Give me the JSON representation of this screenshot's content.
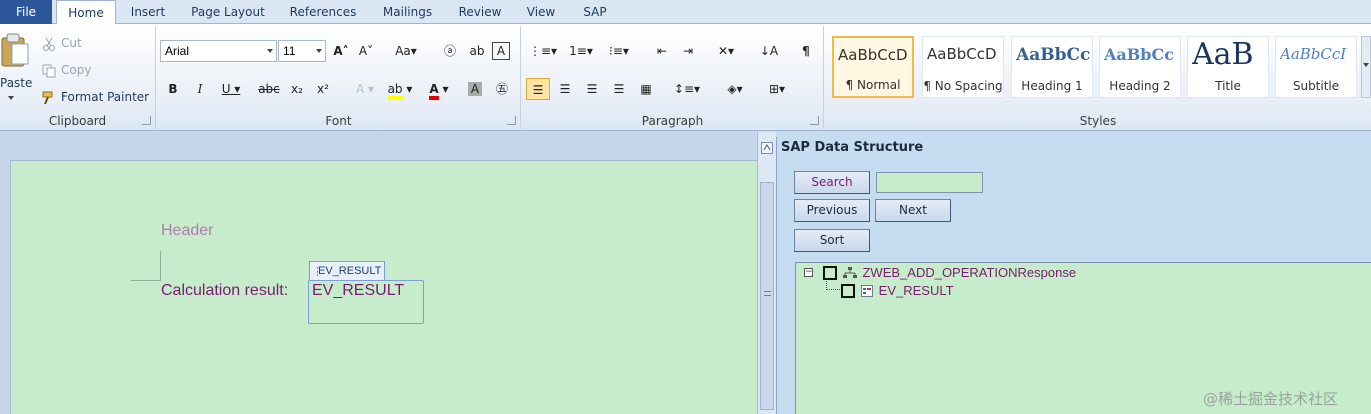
{
  "tabs": {
    "file": "File",
    "items": [
      "Home",
      "Insert",
      "Page Layout",
      "References",
      "Mailings",
      "Review",
      "View",
      "SAP"
    ]
  },
  "clipboard": {
    "paste": "Paste",
    "cut": "Cut",
    "copy": "Copy",
    "format_painter": "Format Painter",
    "label": "Clipboard"
  },
  "font": {
    "family": "Arial",
    "size": "11",
    "label": "Font"
  },
  "paragraph": {
    "label": "Paragraph"
  },
  "styles": {
    "label": "Styles",
    "items": [
      {
        "sample": "AaBbCcD",
        "name": "¶ Normal"
      },
      {
        "sample": "AaBbCcD",
        "name": "¶ No Spacing"
      },
      {
        "sample": "AaBbCc",
        "name": "Heading 1"
      },
      {
        "sample": "AaBbCc",
        "name": "Heading 2"
      },
      {
        "sample": "AaB",
        "name": "Title"
      },
      {
        "sample": "AaBbCcI",
        "name": "Subtitle"
      }
    ]
  },
  "document": {
    "header": "Header",
    "calc_label": "Calculation result:",
    "field_tag": "EV_RESULT",
    "field_value": "EV_RESULT"
  },
  "sap": {
    "title": "SAP Data Structure",
    "search": "Search",
    "previous": "Previous",
    "next": "Next",
    "sort": "Sort",
    "tree": {
      "root": "ZWEB_ADD_OPERATIONResponse",
      "child": "EV_RESULT"
    }
  },
  "watermark": "@稀土掘金技术社区",
  "colors": {
    "file_tab": "#2b579a",
    "page_bg": "#c6eccb",
    "doc_text": "#7a1d6e",
    "header_text": "#b07cb0"
  }
}
